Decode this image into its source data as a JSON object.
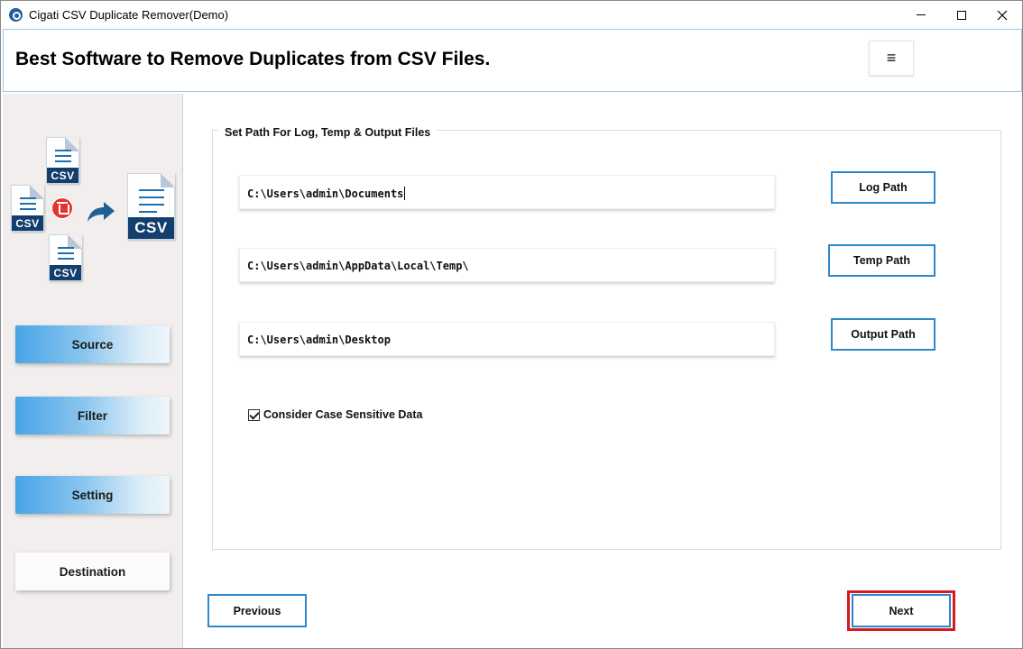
{
  "window": {
    "title": "Cigati CSV Duplicate Remover(Demo)"
  },
  "header": {
    "title": "Best Software to Remove Duplicates from CSV Files.",
    "menu_icon": "≡"
  },
  "sidebar": {
    "illustration": {
      "doc_tag": "CSV"
    },
    "items": [
      {
        "label": "Source",
        "style": "blue"
      },
      {
        "label": "Filter",
        "style": "blue"
      },
      {
        "label": "Setting",
        "style": "blue"
      },
      {
        "label": "Destination",
        "style": "white"
      }
    ]
  },
  "paths_group": {
    "label": "Set Path For Log, Temp & Output Files",
    "log": {
      "value": "C:\\Users\\admin\\Documents",
      "button": "Log Path"
    },
    "temp": {
      "value": "C:\\Users\\admin\\AppData\\Local\\Temp\\",
      "button": "Temp Path"
    },
    "output": {
      "value": "C:\\Users\\admin\\Desktop",
      "button": "Output Path"
    },
    "case_sensitive": {
      "label": "Consider Case Sensitive Data",
      "checked": true
    }
  },
  "navigation": {
    "previous": "Previous",
    "next": "Next"
  },
  "colors": {
    "accent_border": "#2e87c8",
    "highlight": "#d71920",
    "sidebar_bg": "#f2eeee",
    "csv_tag": "#123f6d"
  }
}
